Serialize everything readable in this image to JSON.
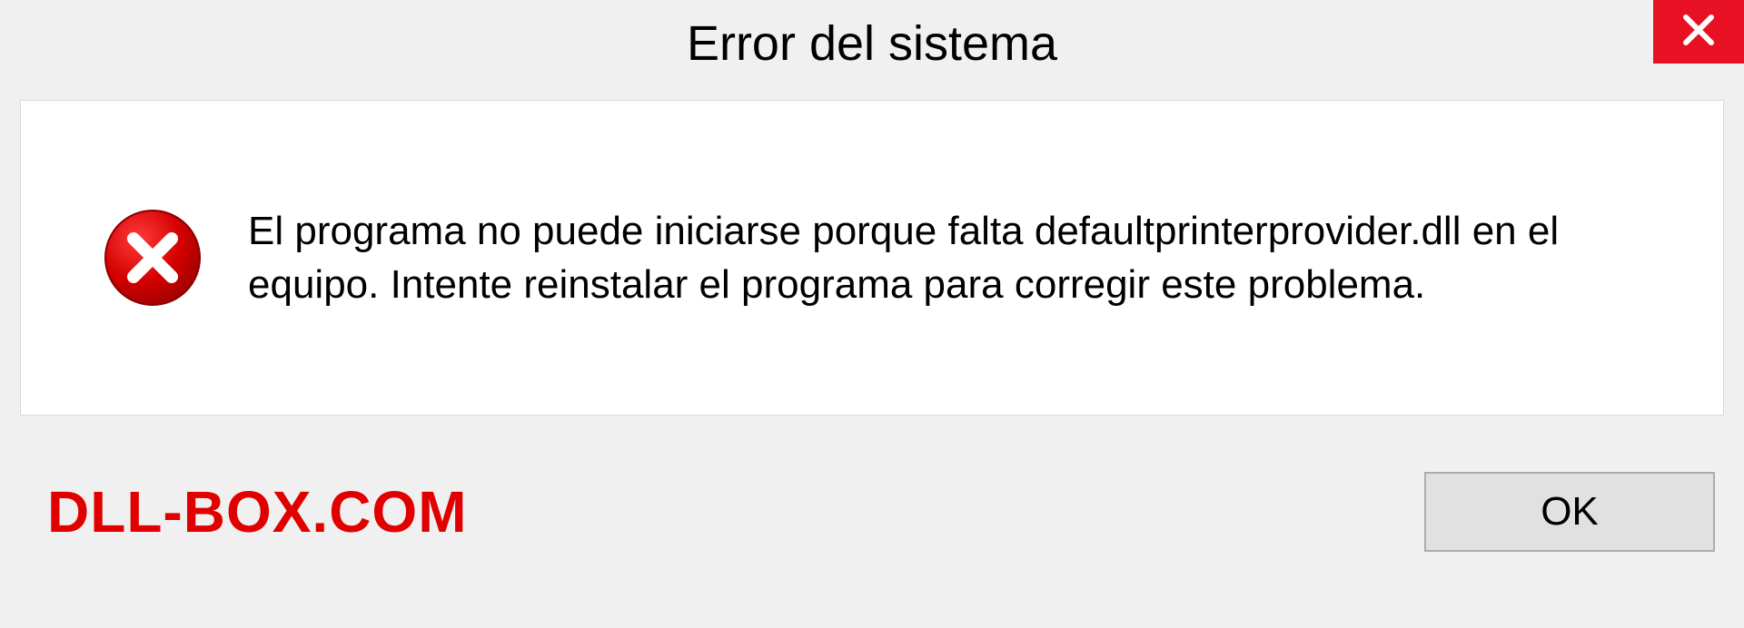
{
  "titlebar": {
    "title": "Error del sistema"
  },
  "content": {
    "message": "El programa no puede iniciarse porque falta defaultprinterprovider.dll en el equipo. Intente reinstalar el programa para corregir este problema."
  },
  "footer": {
    "watermark": "DLL-BOX.COM",
    "ok_label": "OK"
  },
  "colors": {
    "close_bg": "#e81123",
    "error_icon": "#d40000",
    "watermark": "#e00000"
  }
}
